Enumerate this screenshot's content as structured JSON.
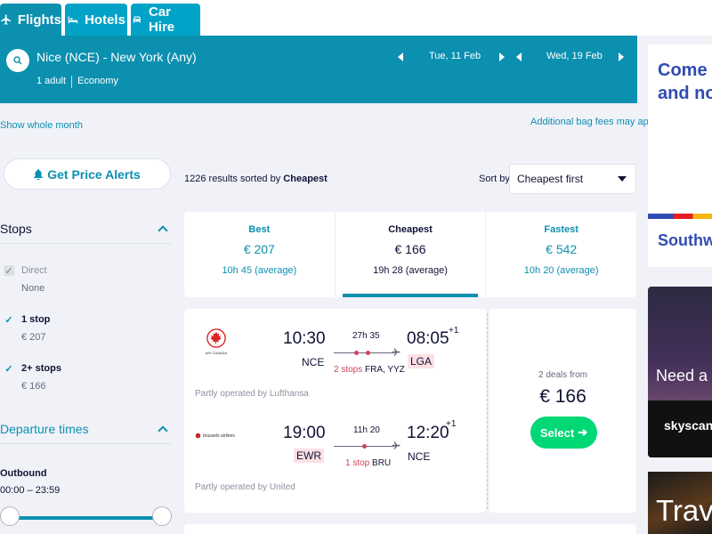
{
  "tabs": [
    {
      "label": "Flights",
      "icon": "plane-icon"
    },
    {
      "label": "Hotels",
      "icon": "bed-icon"
    },
    {
      "label": "Car Hire",
      "icon": "car-icon"
    }
  ],
  "search": {
    "route": "Nice (NCE) - New York (Any)",
    "passengers": "1 adult",
    "cabin": "Economy",
    "depart_date": "Tue, 11 Feb",
    "return_date": "Wed, 19 Feb"
  },
  "links": {
    "whole_month": "Show whole month",
    "bag_fees": "Additional bag fees may apply"
  },
  "price_alerts": "Get Price Alerts",
  "filters": {
    "stops_title": "Stops",
    "stops": [
      {
        "label": "Direct",
        "sub": "None",
        "checked": true,
        "disabled": true
      },
      {
        "label": "1 stop",
        "sub": "€ 207",
        "checked": true,
        "disabled": false
      },
      {
        "label": "2+ stops",
        "sub": "€ 166",
        "checked": true,
        "disabled": false
      }
    ],
    "times_title": "Departure times",
    "outbound_label": "Outbound",
    "outbound_range": "00:00 – 23:59"
  },
  "results": {
    "count_prefix": "1226 results sorted by ",
    "count_sort": "Cheapest",
    "sort_label": "Sort by",
    "sort_value": "Cheapest first"
  },
  "sort_tabs": [
    {
      "title": "Best",
      "price": "€ 207",
      "duration": "10h 45 (average)"
    },
    {
      "title": "Cheapest",
      "price": "€ 166",
      "duration": "19h 28 (average)"
    },
    {
      "title": "Fastest",
      "price": "€ 542",
      "duration": "10h 20 (average)"
    }
  ],
  "itinerary": {
    "outbound": {
      "airline_logo_text": "AIR CANADA",
      "depart_time": "10:30",
      "depart_airport": "NCE",
      "duration": "27h 35",
      "stops_count": "2 stops",
      "stops_via": "FRA, YYZ",
      "arrive_time": "08:05",
      "arrive_day": "+1",
      "arrive_airport": "LGA",
      "operated": "Partly operated by Lufthansa"
    },
    "inbound": {
      "airline_logo_text": "brussels airlines",
      "depart_time": "19:00",
      "depart_airport": "EWR",
      "duration": "11h 20",
      "stops_count": "1 stop",
      "stops_via": "BRU",
      "arrive_time": "12:20",
      "arrive_day": "+1",
      "arrive_airport": "NCE",
      "operated": "Partly operated by United"
    },
    "deals": "2 deals from",
    "price": "€ 166",
    "select": "Select"
  },
  "ads": {
    "ad1_line1": "Come ba",
    "ad1_line2": "and non",
    "ad1_brand": "Southwe",
    "ad2_text": "Need a ho",
    "ad2_brand": "skyscann",
    "ad3_text": "Trave"
  },
  "colors": {
    "brand": "#0c90b0",
    "select": "#00d775",
    "warn": "#d1435b"
  }
}
